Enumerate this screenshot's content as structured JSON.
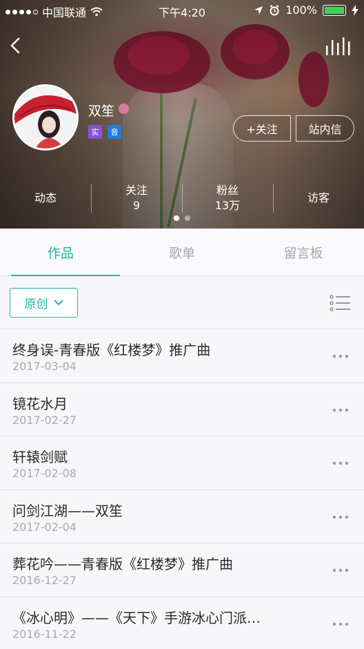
{
  "status_bar": {
    "carrier": "中国联通",
    "time": "下午4:20",
    "battery": "100%",
    "colors": {
      "battery_fill": "#3ed15a"
    }
  },
  "header": {
    "back_icon": "chevron-left-icon",
    "equalizer_icon": "equalizer-icon"
  },
  "profile": {
    "name": "双笙",
    "badge_real": "实",
    "badge_music": "音",
    "follow_label": "+关注",
    "message_label": "站内信"
  },
  "stats": [
    {
      "label": "动态",
      "value": ""
    },
    {
      "label": "关注",
      "value": "9"
    },
    {
      "label": "粉丝",
      "value": "13万"
    },
    {
      "label": "访客",
      "value": ""
    }
  ],
  "pager": {
    "pages": 2,
    "current": 1
  },
  "tabs": [
    {
      "label": "作品",
      "active": true
    },
    {
      "label": "歌单",
      "active": false
    },
    {
      "label": "留言板",
      "active": false
    }
  ],
  "filter": {
    "label": "原创"
  },
  "colors": {
    "accent": "#20b6a2"
  },
  "works": [
    {
      "title": "终身误-青春版《红楼梦》推广曲",
      "date": "2017-03-04"
    },
    {
      "title": "镜花水月",
      "date": "2017-02-27"
    },
    {
      "title": "轩辕剑赋",
      "date": "2017-02-08"
    },
    {
      "title": "问剑江湖——双笙",
      "date": "2017-02-04"
    },
    {
      "title": "葬花吟——青春版《红楼梦》推广曲",
      "date": "2016-12-27"
    },
    {
      "title": "《冰心明》——《天下》手游冰心门派…",
      "date": "2016-11-22"
    }
  ]
}
